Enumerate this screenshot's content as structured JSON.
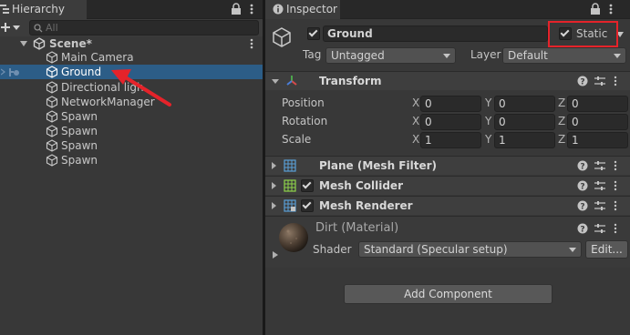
{
  "hierarchy": {
    "tab_title": "Hierarchy",
    "search_placeholder": "All",
    "scene_name": "Scene*",
    "items": [
      {
        "label": "Main Camera"
      },
      {
        "label": "Ground"
      },
      {
        "label": "Directional ligh"
      },
      {
        "label": "NetworkManager"
      },
      {
        "label": "Spawn"
      },
      {
        "label": "Spawn"
      },
      {
        "label": "Spawn"
      },
      {
        "label": "Spawn"
      }
    ]
  },
  "inspector": {
    "tab_title": "Inspector",
    "object_name": "Ground",
    "static_label": "Static",
    "tag_label": "Tag",
    "tag_value": "Untagged",
    "layer_label": "Layer",
    "layer_value": "Default",
    "transform": {
      "title": "Transform",
      "rows": [
        {
          "label": "Position",
          "x": "0",
          "y": "0",
          "z": "0"
        },
        {
          "label": "Rotation",
          "x": "0",
          "y": "0",
          "z": "0"
        },
        {
          "label": "Scale",
          "x": "1",
          "y": "1",
          "z": "1"
        }
      ],
      "axis_x": "X",
      "axis_y": "Y",
      "axis_z": "Z"
    },
    "components": [
      {
        "title": "Plane (Mesh Filter)"
      },
      {
        "title": "Mesh Collider"
      },
      {
        "title": "Mesh Renderer"
      }
    ],
    "material": {
      "name": "Dirt (Material)",
      "shader_label": "Shader",
      "shader_value": "Standard (Specular setup)",
      "edit_label": "Edit..."
    },
    "add_component_label": "Add Component"
  },
  "colors": {
    "selection": "#2c5d87",
    "annotation_red": "#e5232a",
    "panel_bg": "#383838"
  }
}
